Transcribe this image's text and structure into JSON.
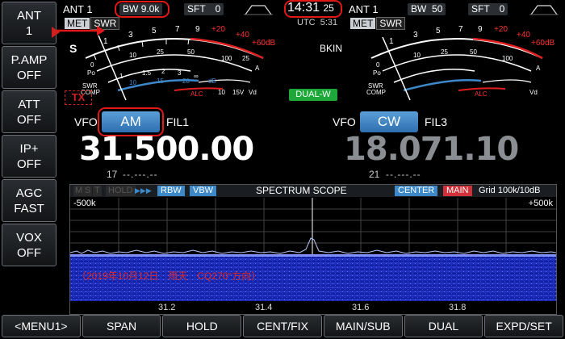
{
  "sidebar": {
    "items": [
      {
        "line1": "ANT",
        "line2": "1"
      },
      {
        "line1": "P.AMP",
        "line2": "OFF"
      },
      {
        "line1": "ATT",
        "line2": "OFF"
      },
      {
        "line1": "IP+",
        "line2": "OFF"
      },
      {
        "line1": "AGC",
        "line2": "FAST"
      },
      {
        "line1": "VOX",
        "line2": "OFF"
      }
    ]
  },
  "main": {
    "ant": "ANT 1",
    "bw_label": "BW",
    "bw_value": "9.0k",
    "sft_label": "SFT",
    "sft_value": "0",
    "met_label": "MET",
    "met_value": "SWR",
    "tx": "TX",
    "vfo": "VFO",
    "mode": "AM",
    "fil": "FIL1",
    "freq": "31.500.00",
    "sub_num": "17",
    "sub_dashes": "--.---.--",
    "s_label": "S"
  },
  "clock": {
    "time": "14:31",
    "seconds": "25",
    "utc_label": "UTC",
    "utc_time": "5:31"
  },
  "sub": {
    "ant": "ANT 1",
    "bw_label": "BW",
    "bw_value": "50",
    "sft_label": "SFT",
    "sft_value": "0",
    "met_label": "MET",
    "met_value": "SWR",
    "bkin": "BKIN",
    "dual": "DUAL-W",
    "vfo": "VFO",
    "mode": "CW",
    "fil": "FIL3",
    "freq": "18.071.10",
    "sub_num": "21",
    "sub_dashes": "--.---.--"
  },
  "meter": {
    "s_ticks": [
      "1",
      "3",
      "5",
      "7",
      "9"
    ],
    "db_ticks": [
      "+20",
      "+40",
      "+60dB"
    ],
    "po_ticks": [
      "0",
      "10",
      "25",
      "50",
      "100"
    ],
    "po_label": "Po",
    "swr_ticks": [
      "1",
      "1.5",
      "2",
      "3",
      "∞"
    ],
    "swr_label": "SWR",
    "comp_label": "COMP",
    "comp_ticks": [
      "10",
      "15",
      "20"
    ],
    "comp_db": "dB",
    "alc_label": "ALC",
    "vd_ticks": [
      "10",
      "15V"
    ],
    "vd_label": "Vd",
    "id_ticks": [
      "0",
      "5",
      "10",
      "15",
      "20",
      "25"
    ],
    "id_label": "A",
    "id_label_left": "Id"
  },
  "scope": {
    "m": "M",
    "s": "S",
    "t": "T",
    "hold": "HOLD",
    "arrows": "▶▶▶",
    "rbw": "RBW",
    "vbw": "VBW",
    "title": "SPECTRUM SCOPE",
    "center": "CENTER",
    "main": "MAIN",
    "grid": "Grid 100k/10dB",
    "left_span": "-500k",
    "right_span": "+500k",
    "annotation": "（2019年10月12日　雨天　CQ270°方向）",
    "axis_labels": [
      "31.2",
      "31.4",
      "31.6",
      "31.8"
    ]
  },
  "bottom": {
    "buttons": [
      "<MENU1>",
      "SPAN",
      "HOLD",
      "CENT/FIX",
      "MAIN/SUB",
      "DUAL",
      "EXPD/SET"
    ]
  },
  "colors": {
    "accent_blue": "#3d88c8",
    "highlight_red": "#e01818",
    "dual_green": "#1fa83a",
    "waterfall_blue": "#0a1fa0"
  }
}
